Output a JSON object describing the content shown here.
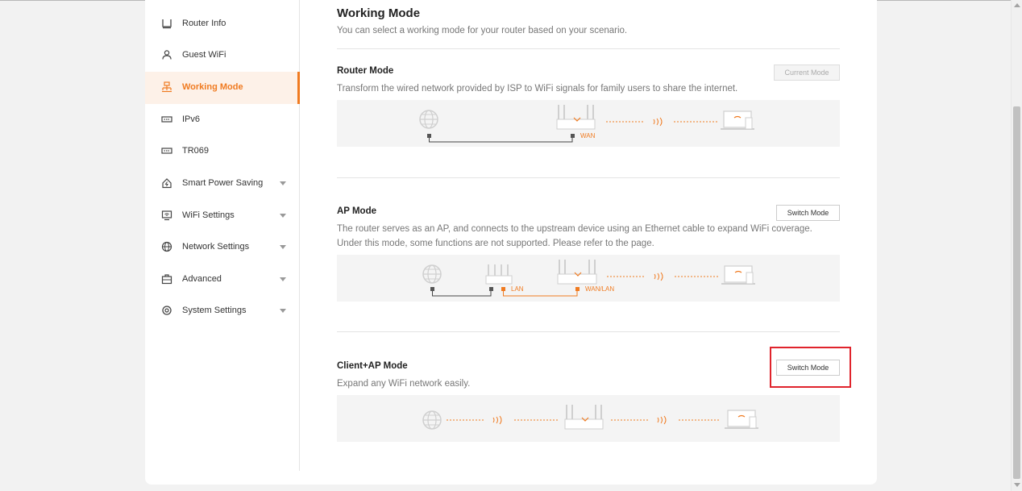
{
  "sidebar": {
    "items": [
      {
        "label": "Router Info",
        "icon": "router-icon",
        "active": false,
        "expandable": false
      },
      {
        "label": "Guest WiFi",
        "icon": "guest-icon",
        "active": false,
        "expandable": false
      },
      {
        "label": "Working Mode",
        "icon": "working-mode-icon",
        "active": true,
        "expandable": false
      },
      {
        "label": "IPv6",
        "icon": "ipv6-icon",
        "active": false,
        "expandable": false
      },
      {
        "label": "TR069",
        "icon": "tr069-icon",
        "active": false,
        "expandable": false
      },
      {
        "label": "Smart Power Saving",
        "icon": "power-saving-icon",
        "active": false,
        "expandable": true
      },
      {
        "label": "WiFi Settings",
        "icon": "wifi-settings-icon",
        "active": false,
        "expandable": true
      },
      {
        "label": "Network Settings",
        "icon": "globe-icon",
        "active": false,
        "expandable": true
      },
      {
        "label": "Advanced",
        "icon": "toolbox-icon",
        "active": false,
        "expandable": true
      },
      {
        "label": "System Settings",
        "icon": "gear-icon",
        "active": false,
        "expandable": true
      }
    ]
  },
  "page": {
    "title": "Working Mode",
    "subtitle": "You can select a working mode for your router based on your scenario."
  },
  "modes": [
    {
      "title": "Router Mode",
      "desc": "Transform the wired network provided by ISP to WiFi signals for family users to share the internet.",
      "desc2": "",
      "button": "Current Mode",
      "current": true,
      "diagram_labels": [
        "WAN"
      ]
    },
    {
      "title": "AP Mode",
      "desc": "The router serves as an AP, and connects to the upstream device using an Ethernet cable to expand WiFi coverage.",
      "desc2": "Under this mode, some functions are not supported. Please refer to the page.",
      "button": "Switch Mode",
      "current": false,
      "diagram_labels": [
        "LAN",
        "WAN/LAN"
      ]
    },
    {
      "title": "Client+AP Mode",
      "desc": "Expand any WiFi network easily.",
      "desc2": "",
      "button": "Switch Mode",
      "current": false,
      "highlighted": true,
      "diagram_labels": []
    }
  ],
  "colors": {
    "accent": "#f07b21",
    "highlight": "#e0242c",
    "background": "#f2f2f2"
  }
}
